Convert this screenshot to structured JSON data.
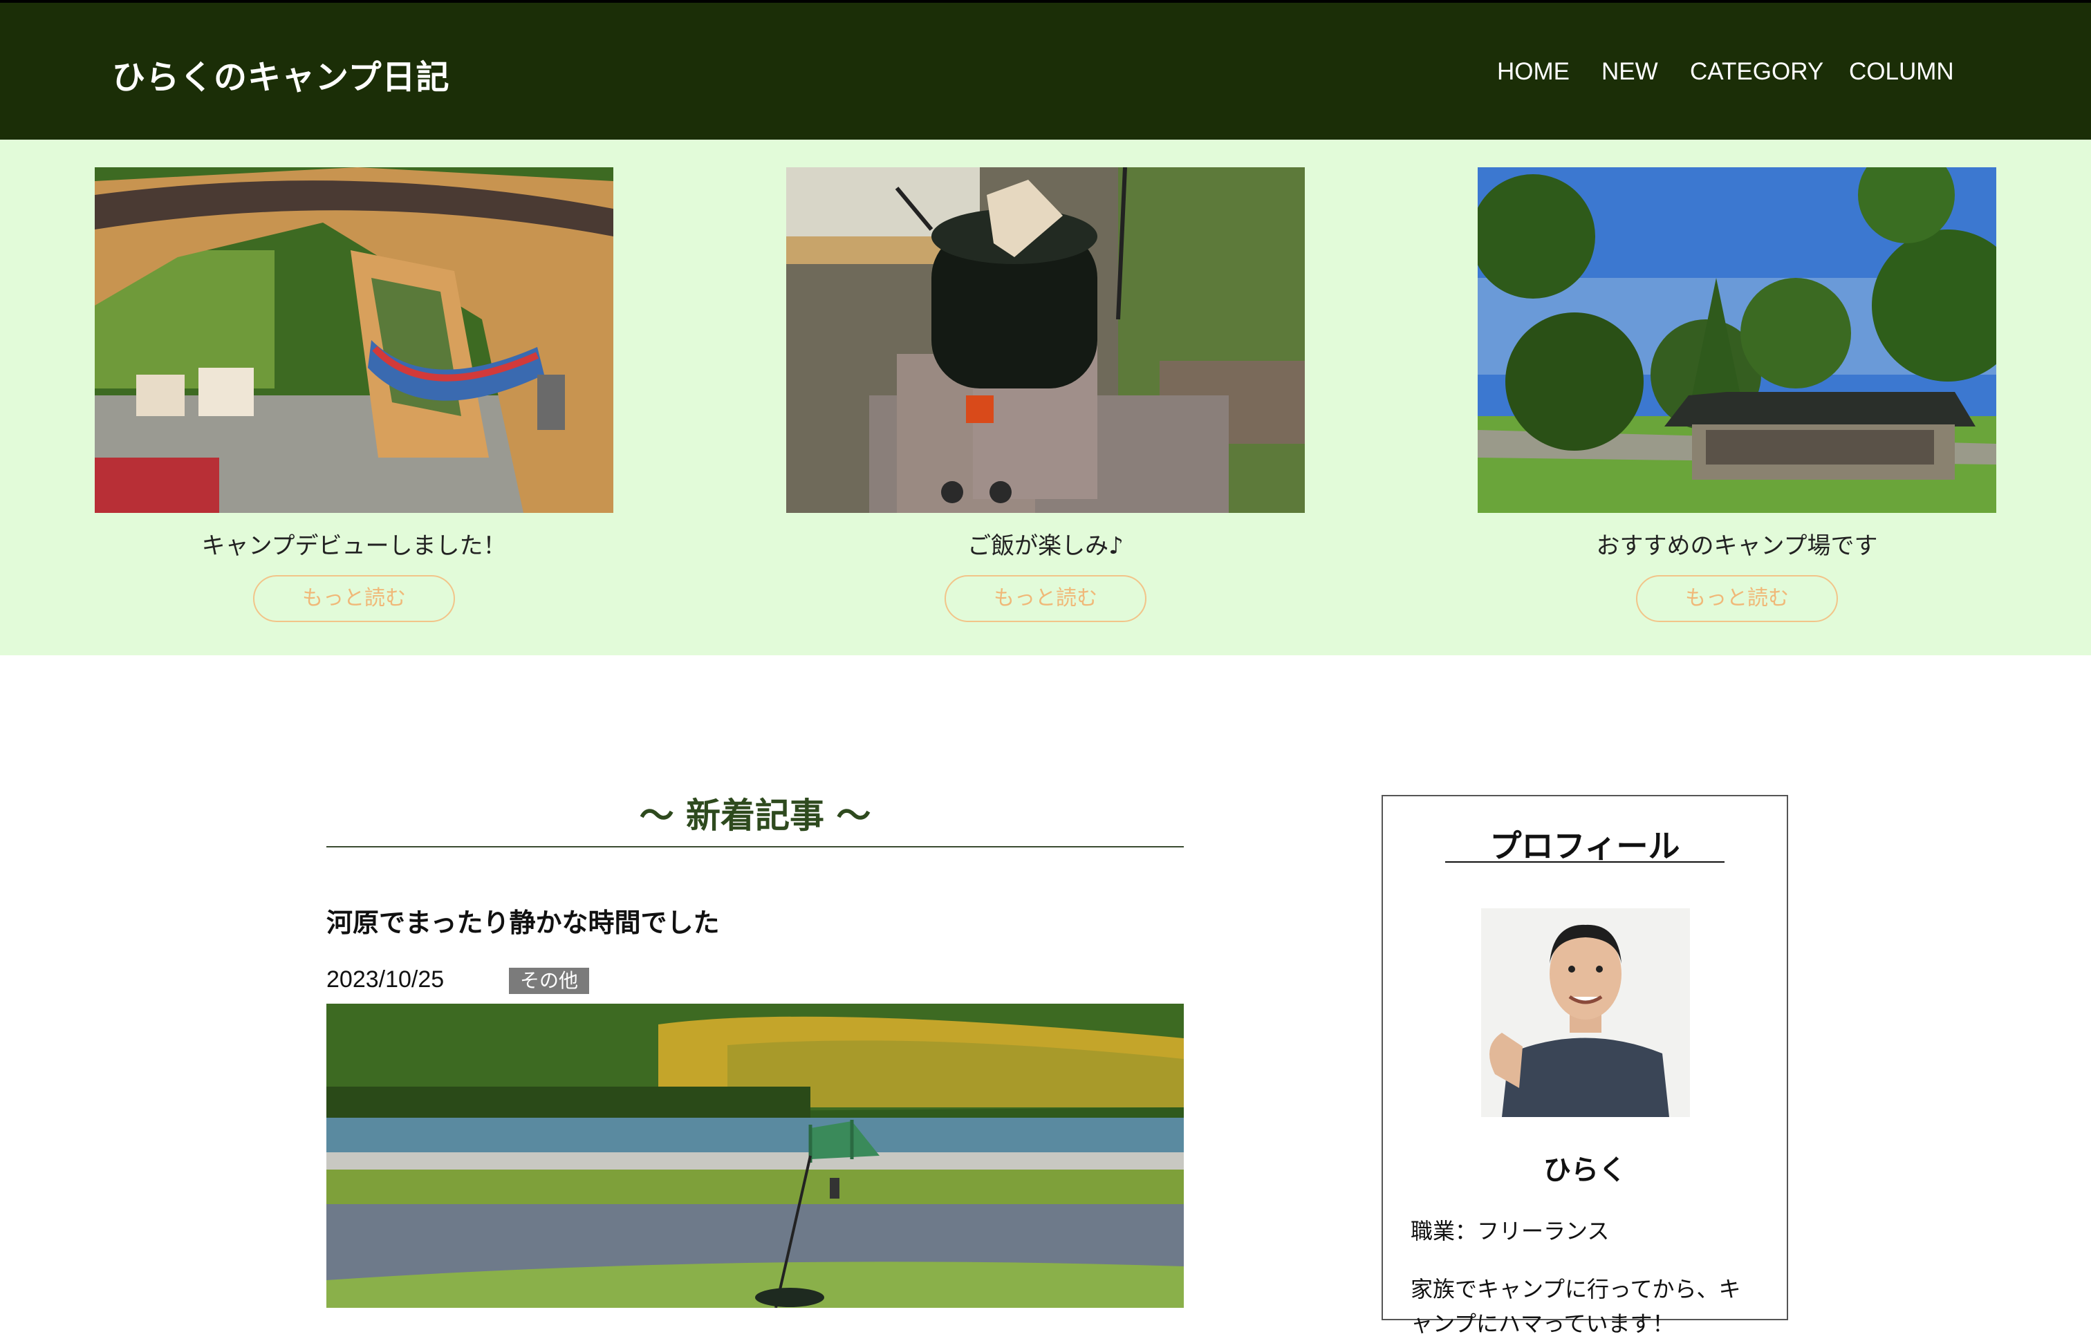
{
  "header": {
    "site_title": "ひらくのキャンプ日記",
    "background": "#1b2e07",
    "nav": [
      "HOME",
      "NEW",
      "CATEGORY",
      "COLUMN"
    ]
  },
  "featured": {
    "background": "#e2fbd9",
    "cards": [
      {
        "caption": "キャンプデビューしました！",
        "button": "もっと読む"
      },
      {
        "caption": "ご飯が楽しみ♪",
        "button": "もっと読む"
      },
      {
        "caption": "おすすめのキャンプ場です",
        "button": "もっと読む"
      }
    ],
    "button_color": "#f0b878"
  },
  "main": {
    "section_title": "〜 新着記事 〜",
    "post": {
      "title": "河原でまったり静かな時間でした",
      "date": "2023/10/25",
      "tag": "その他"
    }
  },
  "sidebar": {
    "heading": "プロフィール",
    "name": "ひらく",
    "job": "職業：フリーランス",
    "bio": "家族でキャンプに行ってから、キャンプにハマっています！"
  }
}
